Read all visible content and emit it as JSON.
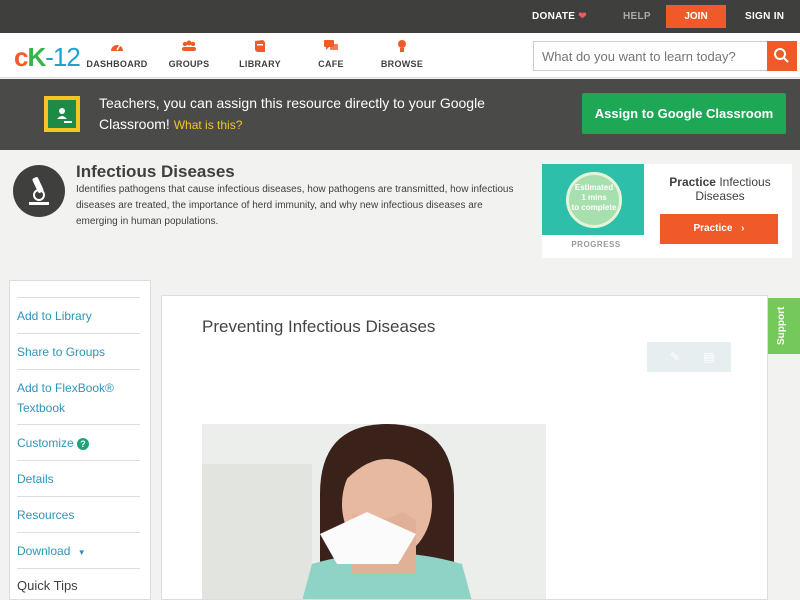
{
  "topbar": {
    "donate": "DONATE",
    "help": "HELP",
    "join": "JOIN",
    "signin": "SIGN IN"
  },
  "header": {
    "logo": {
      "c": "c",
      "k": "K",
      "n": "-12"
    },
    "nav": [
      "DASHBOARD",
      "GROUPS",
      "LIBRARY",
      "CAFE",
      "BROWSE"
    ],
    "search_placeholder": "What do you want to learn today?"
  },
  "banner": {
    "message": "Teachers, you can assign this resource directly to your Google Classroom!",
    "what_link": "What is this?",
    "assign_button": "Assign to Google Classroom"
  },
  "concept": {
    "title": "Infectious Diseases",
    "description": "Identifies pathogens that cause infectious diseases, how pathogens are transmitted, how infectious diseases are treated, the importance of herd immunity, and why new infectious diseases are emerging in human populations."
  },
  "practice": {
    "estimate_line1": "Estimated",
    "estimate_line2": "1 mins",
    "estimate_line3": "to complete",
    "progress_label": "PROGRESS",
    "heading_bold": "Practice",
    "heading_rest": "Infectious Diseases",
    "button": "Practice"
  },
  "sidebar": {
    "items": [
      {
        "label": "Add to Library"
      },
      {
        "label": "Share to Groups"
      },
      {
        "label": "Add to FlexBook®\nTextbook"
      },
      {
        "label": "Customize"
      },
      {
        "label": "Details"
      },
      {
        "label": "Resources"
      },
      {
        "label": "Download"
      }
    ],
    "quick_tips": "Quick Tips"
  },
  "content": {
    "title": "Preventing Infectious Diseases"
  },
  "support": "Support",
  "colors": {
    "accent_orange": "#f05a28",
    "assign_green": "#1ea755",
    "link_blue": "#2e94b8",
    "dark_bar": "#3f3f3d"
  },
  "icons": {
    "dashboard": "gauge-icon",
    "groups": "people-icon",
    "library": "library-icon",
    "cafe": "chat-bubbles-icon",
    "browse": "lightbulb-icon",
    "search": "search-icon",
    "concept": "microscope-icon",
    "practice_arrow": "chevron-right-icon",
    "customize_help": "question-icon",
    "download_menu": "caret-down-icon",
    "tool_1": "pencil-icon",
    "tool_2": "notes-icon"
  }
}
